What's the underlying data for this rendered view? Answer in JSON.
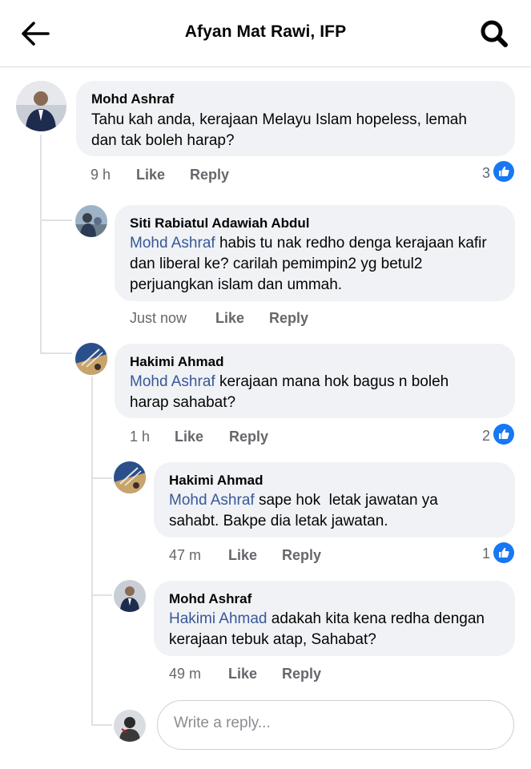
{
  "header": {
    "title": "Afyan Mat Rawi, IFP",
    "back_icon": "arrow-left-icon",
    "search_icon": "search-icon"
  },
  "colors": {
    "mention": "#385898",
    "like_blue": "#1877f2",
    "bubble": "#f0f2f5",
    "meta": "#65676b"
  },
  "comments": [
    {
      "author": "Mohd Ashraf",
      "text": "Tahu kah anda, kerajaan Melayu Islam hopeless, lemah dan tak boleh harap?",
      "time": "9 h",
      "like_label": "Like",
      "reply_label": "Reply",
      "reactions": "3"
    },
    {
      "author": "Siti Rabiatul Adawiah Abdul",
      "mention": "Mohd Ashraf",
      "text": "habis tu nak redho denga kerajaan kafir dan liberal ke? carilah pemimpin2 yg betul2 perjuangkan islam dan ummah.",
      "time": "Just now",
      "like_label": "Like",
      "reply_label": "Reply"
    },
    {
      "author": "Hakimi Ahmad",
      "mention": "Mohd Ashraf",
      "text": "kerajaan mana hok bagus n boleh harap sahabat?",
      "time": "1 h",
      "like_label": "Like",
      "reply_label": "Reply",
      "reactions": "2"
    },
    {
      "author": "Hakimi Ahmad",
      "mention": "Mohd Ashraf",
      "text": "sape hok  letak jawatan ya sahabt. Bakpe dia letak jawatan.",
      "time": "47 m",
      "like_label": "Like",
      "reply_label": "Reply",
      "reactions": "1"
    },
    {
      "author": "Mohd Ashraf",
      "mention": "Hakimi Ahmad",
      "text": "adakah kita kena redha dengan kerajaan tebuk atap, Sahabat?",
      "time": "49 m",
      "like_label": "Like",
      "reply_label": "Reply"
    }
  ],
  "reply_box": {
    "placeholder": "Write a reply..."
  }
}
